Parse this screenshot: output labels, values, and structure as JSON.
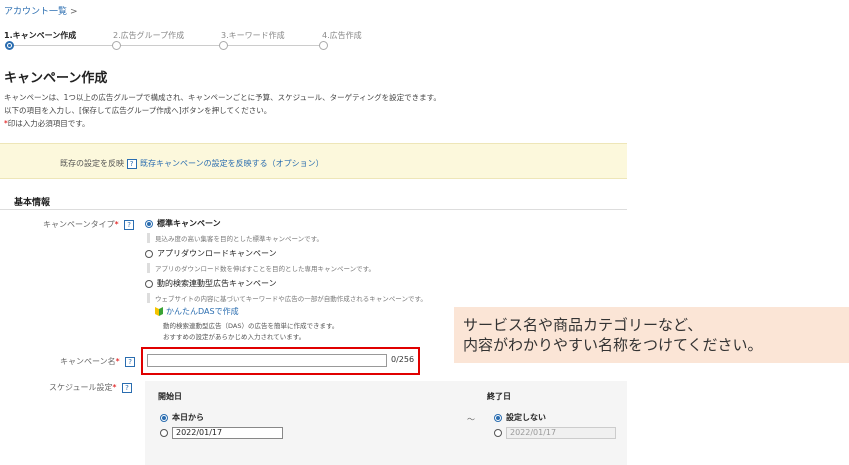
{
  "breadcrumb": {
    "link": "アカウント一覧",
    "separator": ">"
  },
  "steps": [
    {
      "label": "1.キャンペーン作成",
      "active": true
    },
    {
      "label": "2.広告グループ作成",
      "active": false
    },
    {
      "label": "3.キーワード作成",
      "active": false
    },
    {
      "label": "4.広告作成",
      "active": false
    }
  ],
  "page": {
    "title": "キャンペーン作成",
    "desc1": "キャンペーンは、1つ以上の広告グループで構成され、キャンペーンごとに予算、スケジュール、ターゲティングを設定できます。",
    "desc2": "以下の項目を入力し、[保存して広告グループ作成へ]ボタンを押してください。",
    "required_mark": "*",
    "required_note": "印は入力必須項目です。"
  },
  "existing": {
    "label": "既存の設定を反映",
    "help": "?",
    "link": "既存キャンペーンの設定を反映する（オプション）"
  },
  "section": {
    "title": "基本情報"
  },
  "campaign_type": {
    "label": "キャンペーンタイプ",
    "required": "*",
    "help": "?",
    "options": [
      {
        "label": "標準キャンペーン",
        "desc": "見込み度の高い集客を目的とした標準キャンペーンです。",
        "selected": true
      },
      {
        "label": "アプリダウンロードキャンペーン",
        "desc": "アプリのダウンロード数を伸ばすことを目的とした専用キャンペーンです。",
        "selected": false
      },
      {
        "label": "動的検索連動型広告キャンペーン",
        "desc": "ウェブサイトの内容に基づいてキーワードや広告の一部が自動作成されるキャンペーンです。",
        "selected": false
      }
    ],
    "das": {
      "link": "かんたんDASで作成",
      "desc1": "動的検索連動型広告（DAS）の広告を簡単に作成できます。",
      "desc2": "おすすめの設定があらかじめ入力されています。"
    }
  },
  "campaign_name": {
    "label": "キャンペーン名",
    "required": "*",
    "help": "?",
    "value": "",
    "counter": "0/256"
  },
  "schedule": {
    "label": "スケジュール設定",
    "required": "*",
    "help": "?",
    "start": {
      "header": "開始日",
      "opt_today": "本日から",
      "date": "2022/01/17"
    },
    "tilde": "～",
    "end": {
      "header": "終了日",
      "opt_none": "設定しない",
      "date": "2022/01/17"
    }
  },
  "callout": {
    "line1": "サービス名や商品カテゴリーなど、",
    "line2": "内容がわかりやすい名称をつけてください。"
  },
  "colors": {
    "accent": "#2a6db0",
    "highlight": "#e00000",
    "notice_bg": "#fcf8dc",
    "callout_bg": "#fbe5d6"
  }
}
